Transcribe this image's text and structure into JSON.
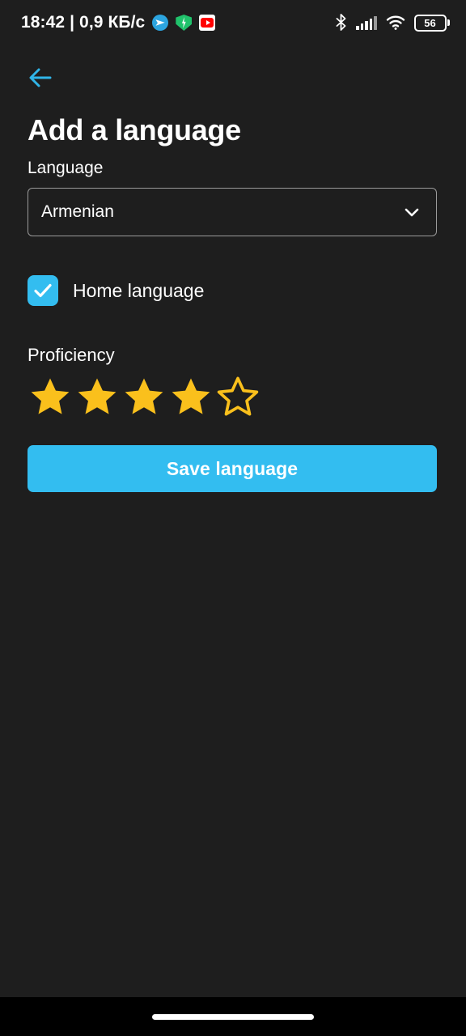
{
  "status_bar": {
    "clock_and_net": "18:42 | 0,9 КБ/с",
    "notification_icons": [
      "telegram-icon",
      "shield-vpn-icon",
      "youtube-icon"
    ],
    "right_icons": [
      "bluetooth-icon",
      "cellular-signal-icon",
      "wifi-icon"
    ],
    "battery_level": "56"
  },
  "nav": {
    "back_icon": "arrow-left-icon"
  },
  "page": {
    "title": "Add a language"
  },
  "language_field": {
    "label": "Language",
    "selected_value": "Armenian",
    "chevron_icon": "chevron-down-icon"
  },
  "home_language": {
    "label": "Home language",
    "checked": true,
    "check_icon": "check-icon"
  },
  "proficiency": {
    "label": "Proficiency",
    "rating": 4,
    "max": 5,
    "stars": [
      {
        "filled": true
      },
      {
        "filled": true
      },
      {
        "filled": true
      },
      {
        "filled": true
      },
      {
        "filled": false
      }
    ]
  },
  "save": {
    "label": "Save language"
  },
  "colors": {
    "background": "#1e1e1e",
    "accent_blue": "#33bdf0",
    "star_gold": "#fac01c",
    "text_primary": "#ffffff",
    "border_grey": "#9a9a9a",
    "nav_black": "#000000"
  }
}
